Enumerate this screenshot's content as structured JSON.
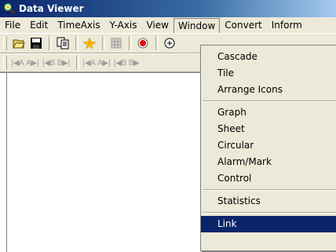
{
  "window": {
    "title": "Data Viewer",
    "icon": "magnifier-app-icon"
  },
  "menubar": {
    "items": [
      {
        "label": "File"
      },
      {
        "label": "Edit"
      },
      {
        "label": "TimeAxis"
      },
      {
        "label": "Y-Axis"
      },
      {
        "label": "View"
      },
      {
        "label": "Window"
      },
      {
        "label": "Convert"
      },
      {
        "label": "Inform"
      }
    ],
    "open_menu": "Window"
  },
  "toolbar": {
    "buttons": [
      {
        "icon": "open-folder-icon"
      },
      {
        "icon": "save-disk-icon"
      },
      {
        "icon": "copy-icon"
      },
      {
        "icon": "sparkle-icon"
      },
      {
        "icon": "grid-icon"
      },
      {
        "icon": "record-icon"
      },
      {
        "icon": "zoom-icon"
      }
    ]
  },
  "nav_toolbar": {
    "buttons": [
      {
        "label": "|◀A A▶|"
      },
      {
        "label": "|◀B B▶|"
      },
      {
        "label": "|◀A A▶|"
      },
      {
        "label": "|◀B B▶"
      }
    ]
  },
  "window_menu": {
    "groups": [
      [
        "Cascade",
        "Tile",
        "Arrange Icons"
      ],
      [
        "Graph",
        "Sheet",
        "Circular",
        "Alarm/Mark",
        "Control"
      ],
      [
        "Statistics"
      ],
      [
        "Link"
      ]
    ],
    "highlighted": "Link"
  },
  "colors": {
    "titlebar_start": "#0a246a",
    "face": "#ece9d8",
    "highlight": "#0a246a"
  }
}
